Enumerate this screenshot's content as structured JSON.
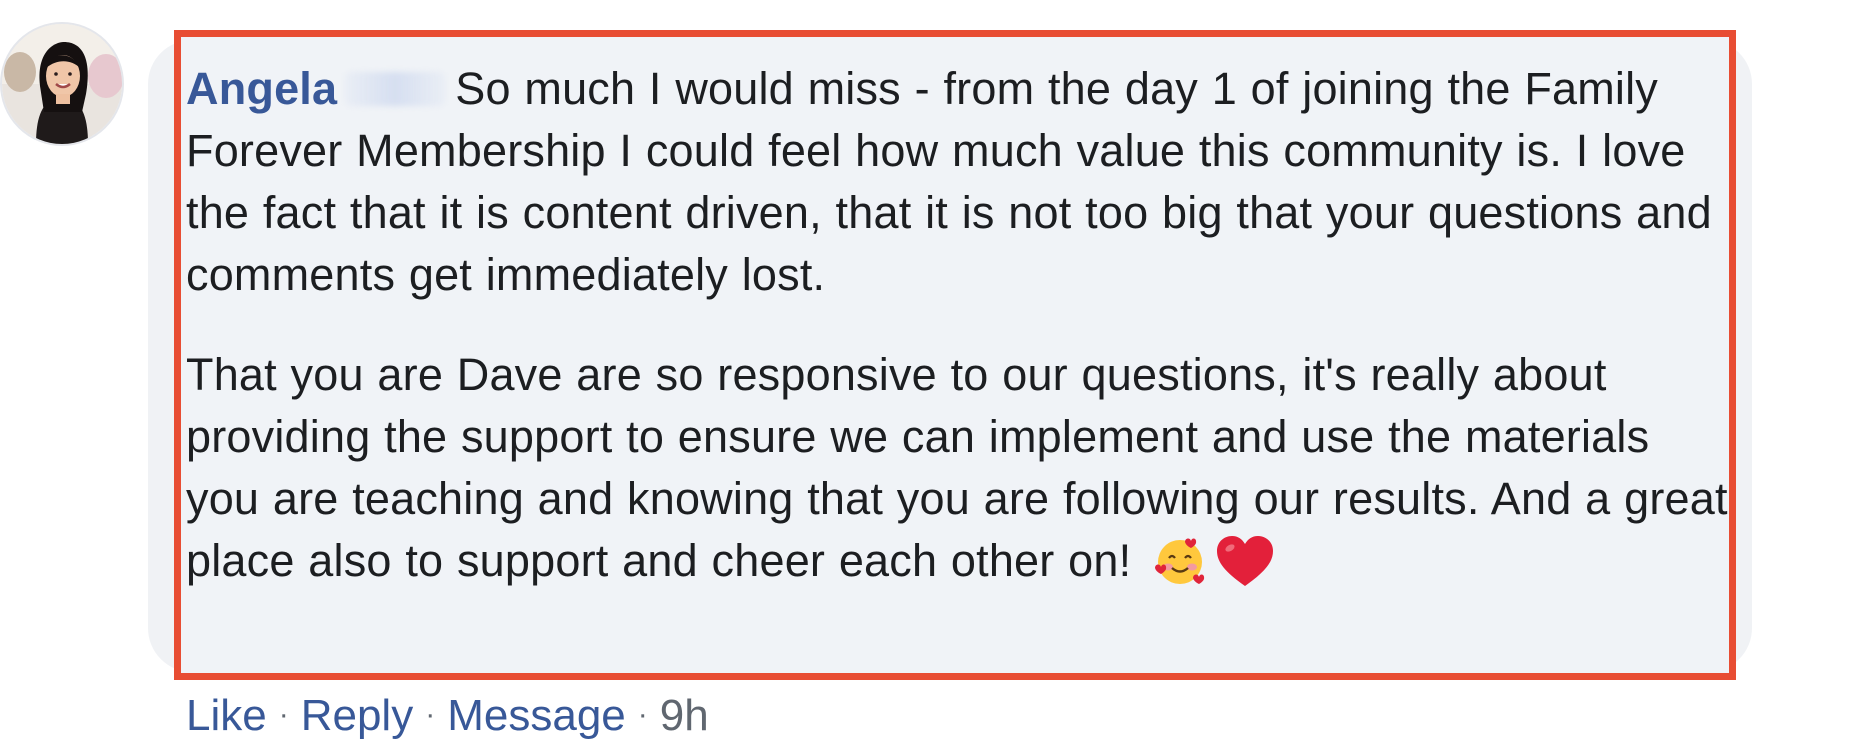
{
  "comment": {
    "author": "Angela",
    "paragraph1": "So much I would miss - from the day 1 of joining the Family Forever Membership I could feel how much value this community is. I love the fact that it is content driven, that it is not too big that your questions and comments get immediately lost.",
    "paragraph2": "That you are Dave are so responsive to our questions, it's really about providing the support to ensure we can implement and use the materials you are teaching and knowing that you are following our results. And a great place also to support and cheer each other on!",
    "emojis": [
      "smiling-face-with-hearts-icon",
      "red-heart-icon"
    ]
  },
  "actions": {
    "like": "Like",
    "reply": "Reply",
    "message": "Message",
    "separator": "·",
    "time": "9h"
  },
  "colors": {
    "author_link": "#385898",
    "text": "#1c1e21",
    "meta": "#606770",
    "highlight_border": "#e84d33",
    "bubble": "#f0f2f5"
  }
}
